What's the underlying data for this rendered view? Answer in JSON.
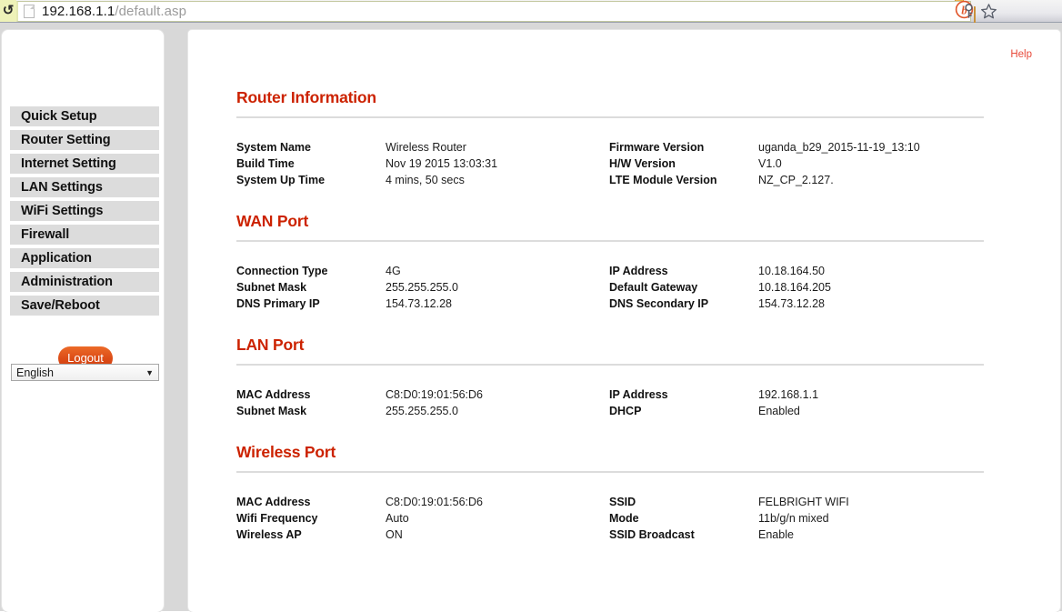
{
  "browser": {
    "url_host": "192.168.1.1",
    "url_path": "/default.asp",
    "reload_icon": "reload-icon",
    "page_icon": "page-document-icon",
    "key_icon": "key-icon",
    "star_icon": "bookmark-star-icon",
    "b_logo": "b-logo-icon",
    "folder_icon": "folder-icon"
  },
  "sidebar": {
    "items": [
      {
        "label": "Quick Setup"
      },
      {
        "label": "Router Setting"
      },
      {
        "label": "Internet Setting"
      },
      {
        "label": "LAN Settings"
      },
      {
        "label": "WiFi Settings"
      },
      {
        "label": "Firewall"
      },
      {
        "label": "Application"
      },
      {
        "label": "Administration"
      },
      {
        "label": "Save/Reboot"
      }
    ],
    "logout_label": "Logout",
    "language_value": "English",
    "language_arrow": "▼"
  },
  "content": {
    "help_label": "Help",
    "sections": [
      {
        "title": "Router Information",
        "rows": [
          {
            "left_label": "System Name",
            "left_value": "Wireless Router",
            "right_label": "Firmware Version",
            "right_value": "uganda_b29_2015-11-19_13:10"
          },
          {
            "left_label": "Build Time",
            "left_value": "Nov 19 2015 13:03:31",
            "right_label": "H/W Version",
            "right_value": "V1.0"
          },
          {
            "left_label": "System Up Time",
            "left_value": "4 mins, 50 secs",
            "right_label": "LTE Module Version",
            "right_value": "NZ_CP_2.127."
          }
        ]
      },
      {
        "title": "WAN Port",
        "rows": [
          {
            "left_label": "Connection Type",
            "left_value": "4G",
            "right_label": "IP Address",
            "right_value": "10.18.164.50"
          },
          {
            "left_label": "Subnet Mask",
            "left_value": "255.255.255.0",
            "right_label": "Default Gateway",
            "right_value": "10.18.164.205"
          },
          {
            "left_label": "DNS Primary IP",
            "left_value": "154.73.12.28",
            "right_label": "DNS Secondary IP",
            "right_value": "154.73.12.28"
          }
        ]
      },
      {
        "title": "LAN Port",
        "rows": [
          {
            "left_label": "MAC Address",
            "left_value": "C8:D0:19:01:56:D6",
            "right_label": "IP Address",
            "right_value": "192.168.1.1"
          },
          {
            "left_label": "Subnet Mask",
            "left_value": "255.255.255.0",
            "right_label": "DHCP",
            "right_value": "Enabled"
          }
        ]
      },
      {
        "title": "Wireless Port",
        "rows": [
          {
            "left_label": "MAC Address",
            "left_value": "C8:D0:19:01:56:D6",
            "right_label": "SSID",
            "right_value": "FELBRIGHT WIFI"
          },
          {
            "left_label": "Wifi Frequency",
            "left_value": "Auto",
            "right_label": "Mode",
            "right_value": "11b/g/n mixed"
          },
          {
            "left_label": "Wireless AP",
            "left_value": "ON",
            "right_label": "SSID Broadcast",
            "right_value": "Enable"
          }
        ]
      }
    ]
  },
  "colors": {
    "heading_red": "#cc2200",
    "help_red": "#e8493a",
    "logout_orange": "#dc4c17",
    "nav_gray": "#dcdcdc",
    "page_gray": "#d8d8d8"
  }
}
